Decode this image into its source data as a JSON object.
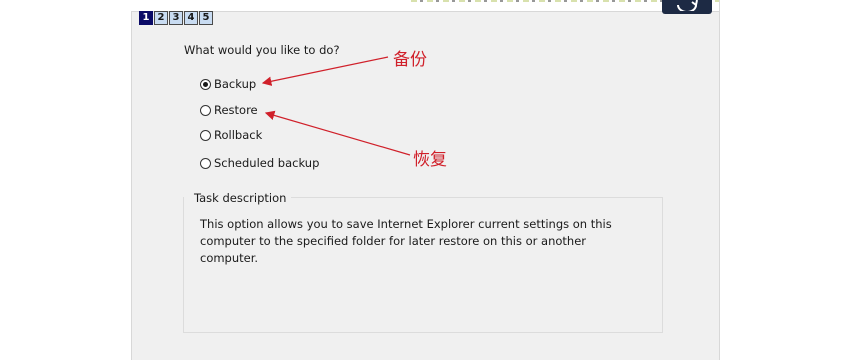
{
  "wizard": {
    "steps": [
      "1",
      "2",
      "3",
      "4",
      "5"
    ],
    "active_step": "1"
  },
  "question": "What would you like to do?",
  "options": [
    {
      "label": "Backup",
      "selected": true
    },
    {
      "label": "Restore",
      "selected": false
    },
    {
      "label": "Rollback",
      "selected": false
    },
    {
      "label": "Scheduled backup",
      "selected": false
    }
  ],
  "task": {
    "legend": "Task description",
    "text": "This option allows you to save Internet Explorer current settings on this computer to the specified folder for later restore on this or another computer."
  },
  "annotations": {
    "backup_note": "备份",
    "restore_note": "恢复",
    "color": "#d0202a"
  },
  "icons": {
    "logo": "refresh-logo-icon"
  },
  "colors": {
    "dialog_bg": "#f0f0f0",
    "active_step": "#0a0a66",
    "inactive_step": "#c9dcf2"
  }
}
